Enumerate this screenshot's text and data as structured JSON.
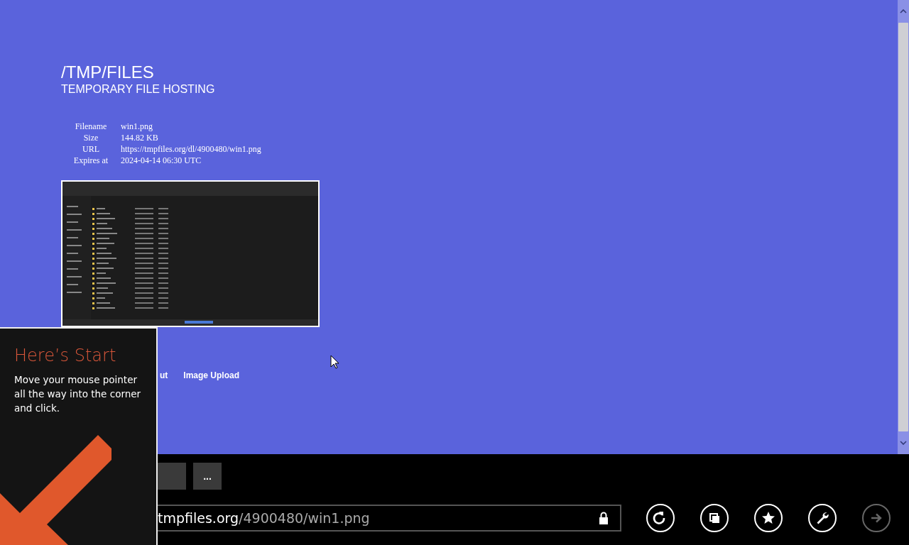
{
  "header": {
    "title": "/TMP/FILES",
    "subtitle": "TEMPORARY FILE HOSTING"
  },
  "file_info": [
    {
      "label": "Filename",
      "value": "win1.png"
    },
    {
      "label": "Size",
      "value": "144.82 KB"
    },
    {
      "label": "URL",
      "value": "https://tmpfiles.org/dl/4900480/win1.png"
    },
    {
      "label": "Expires at",
      "value": "2024-04-14 06:30 UTC"
    }
  ],
  "nav_links": [
    {
      "label": "ut"
    },
    {
      "label": "Image Upload"
    }
  ],
  "browser_bar": {
    "more_button": "...",
    "address_host": "tmpfiles.org",
    "address_path": "/4900480/win1.png",
    "buttons": [
      {
        "kind": "refresh",
        "disabled": false
      },
      {
        "kind": "tabs",
        "disabled": false
      },
      {
        "kind": "favorite",
        "disabled": false
      },
      {
        "kind": "tools",
        "disabled": false
      },
      {
        "kind": "forward",
        "disabled": true
      }
    ]
  },
  "start_tip": {
    "title": "Here’s Start",
    "text": "Move your mouse pointer all the way into the corner and click."
  }
}
